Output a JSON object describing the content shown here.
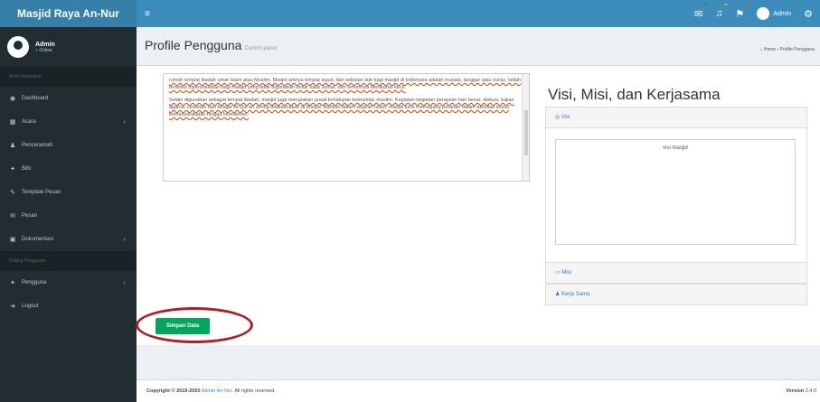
{
  "app": {
    "title": "Masjid Raya An-Nur"
  },
  "topbar": {
    "toggle_icon": "hamburger-icon",
    "icons": [
      {
        "name": "envelope-icon",
        "glyph": "✉",
        "badge": "",
        "badge_color": "#00a65a"
      },
      {
        "name": "bell-icon",
        "glyph": "🔔",
        "badge": "",
        "badge_color": "#f39c12"
      },
      {
        "name": "flag-icon",
        "glyph": "⚑",
        "badge": "",
        "badge_color": "#dd4b39"
      }
    ],
    "user": "Admin",
    "settings_icon": "gear-icon"
  },
  "sidebar": {
    "user": {
      "name": "Admin",
      "status": "Online"
    },
    "header1": "Main Navigation",
    "items": [
      {
        "label": "Dashboard",
        "icon": "dashboard-icon",
        "glyph": "◉",
        "chevron": false
      },
      {
        "label": "Acara",
        "icon": "calendar-icon",
        "glyph": "▦",
        "chevron": true
      },
      {
        "label": "Penceramah",
        "icon": "user-icon",
        "glyph": "♟",
        "chevron": false
      },
      {
        "label": "Bibi",
        "icon": "group-icon",
        "glyph": "✦",
        "chevron": false
      },
      {
        "label": "Template Pesan",
        "icon": "edit-icon",
        "glyph": "✎",
        "chevron": false
      },
      {
        "label": "Pesan",
        "icon": "envelope-icon",
        "glyph": "✉",
        "chevron": false
      },
      {
        "label": "Dokumentasi",
        "icon": "image-icon",
        "glyph": "▣",
        "chevron": true
      }
    ],
    "header2": "Setting Pengguna",
    "items2": [
      {
        "label": "Pengguna",
        "icon": "users-icon",
        "glyph": "✦",
        "chevron": true
      },
      {
        "label": "Logout",
        "icon": "logout-icon",
        "glyph": "➜",
        "chevron": false
      }
    ]
  },
  "page": {
    "title": "Profile Pengguna",
    "subtitle": "Control panel",
    "breadcrumb": "Home › Profile Pengguna"
  },
  "content": {
    "paragraphs": [
      "rumah tempat ibadah umat Islam atau Muslim. Masjid artinya tempat sujud, dan sebutan lain bagi masjid di Indonesia adalah musala, langgar atau surau. Istilah tersebut diperuntukkan bagi masjid yang tidak digunakan untuk salat Jumat, dan umumnya berukuran kecil.",
      "Selain digunakan sebagai tempat ibadah, masjid juga merupakan pusat kehidupan komunitas muslim. Kegiatan-kegiatan perayaan hari besar, diskusi, kajian agama, ceramah dan belajar Al-Qur'an sering dilaksanakan di Masjid. Bahkan dalam sejarah Islam, masjid turut memegang peranan dalam aktivitas sosial kemasyarakatan hingga kemiliteran."
    ],
    "visi_heading": "Visi, Misi, dan Kerjasama",
    "panel_visi_label": "Visi",
    "visi_text": "visi masjid",
    "panel_misi_label": "Misi",
    "panel_kerjasama_label": "Kerja Sama",
    "save_button": "Simpan Data"
  },
  "footer": {
    "copyright_prefix": "Copyright © 2019-2020",
    "brand": "Admin An-Nur.",
    "rights": "All rights reserved.",
    "version_label": "Version",
    "version": "2.4.0"
  }
}
